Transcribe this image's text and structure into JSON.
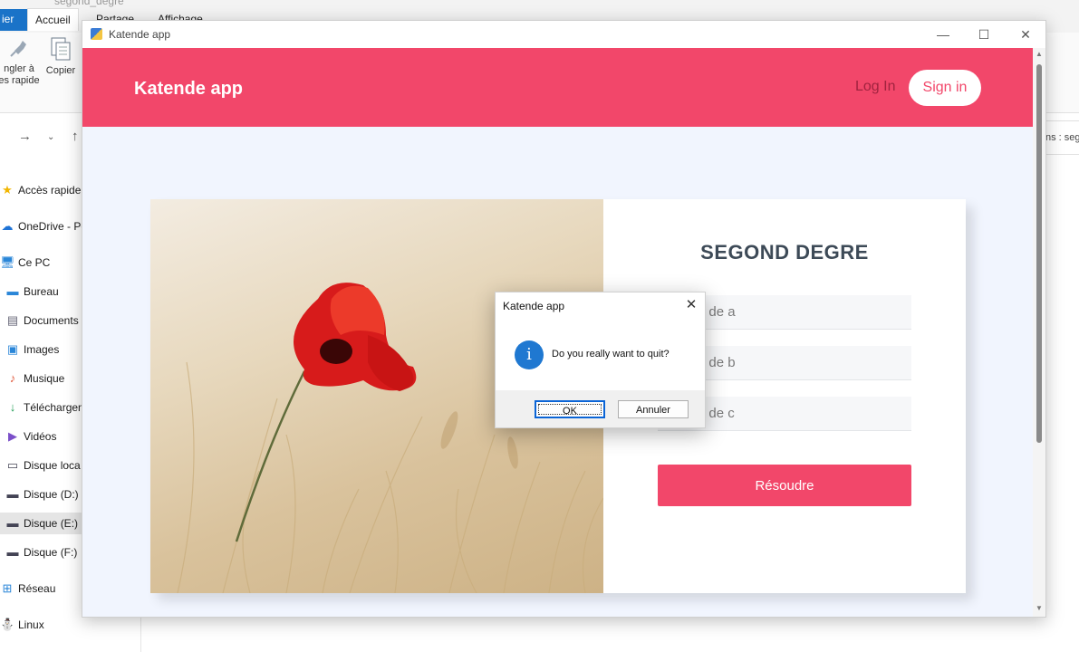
{
  "explorer": {
    "title": "segond_degre",
    "tabs": [
      "Fichier",
      "Accueil",
      "Partage",
      "Affichage"
    ],
    "ribbon_buttons": [
      {
        "label_line1": "Épingler à",
        "label_line2": "Accès rapide",
        "icon": "pin-icon"
      },
      {
        "label_line1": "Copier",
        "label_line2": "",
        "icon": "copy-icon"
      }
    ],
    "address_partial": "ns : sego",
    "sidebar": [
      {
        "label": "Accès rapide",
        "icon": "star-icon",
        "selected": false
      },
      {
        "label": "OneDrive - Pe",
        "icon": "cloud-icon",
        "selected": false
      },
      {
        "label": "Ce PC",
        "icon": "computer-icon",
        "selected": false
      },
      {
        "label": "Bureau",
        "icon": "desktop-icon",
        "selected": false
      },
      {
        "label": "Documents",
        "icon": "documents-icon",
        "selected": false
      },
      {
        "label": "Images",
        "icon": "images-icon",
        "selected": false
      },
      {
        "label": "Musique",
        "icon": "music-icon",
        "selected": false
      },
      {
        "label": "Téléchargem",
        "icon": "download-icon",
        "selected": false
      },
      {
        "label": "Vidéos",
        "icon": "videos-icon",
        "selected": false
      },
      {
        "label": "Disque loca",
        "icon": "drive-icon",
        "selected": false
      },
      {
        "label": "Disque (D:)",
        "icon": "drive-icon",
        "selected": false
      },
      {
        "label": "Disque (E:)",
        "icon": "drive-icon",
        "selected": true
      },
      {
        "label": "Disque (F:)",
        "icon": "drive-icon",
        "selected": false
      },
      {
        "label": "Réseau",
        "icon": "network-icon",
        "selected": false
      },
      {
        "label": "Linux",
        "icon": "linux-icon",
        "selected": false
      }
    ]
  },
  "window": {
    "title": "Katende app",
    "controls": {
      "minimize": "—",
      "maximize": "☐",
      "close": "✕"
    }
  },
  "header": {
    "brand": "Katende app",
    "login_label": "Log In",
    "signin_label": "Sign in"
  },
  "form": {
    "title": "SEGOND DEGRE",
    "fields": [
      {
        "placeholder": "Valeur de a",
        "visible_text": "ur de a"
      },
      {
        "placeholder": "Valeur de b",
        "visible_text": "ur de b"
      },
      {
        "placeholder": "Valeur de c",
        "visible_text": "ur de c"
      }
    ],
    "solve_label": "Résoudre"
  },
  "dialog": {
    "title": "Katende app",
    "message": "Do you really want to quit?",
    "icon": "info-icon",
    "ok_label": "OK",
    "cancel_label": "Annuler",
    "close_label": "✕"
  },
  "colors": {
    "accent": "#f2476a",
    "app_background": "#f1f5fe",
    "title_text": "#3d4a57",
    "dialog_info": "#1f78d1"
  }
}
